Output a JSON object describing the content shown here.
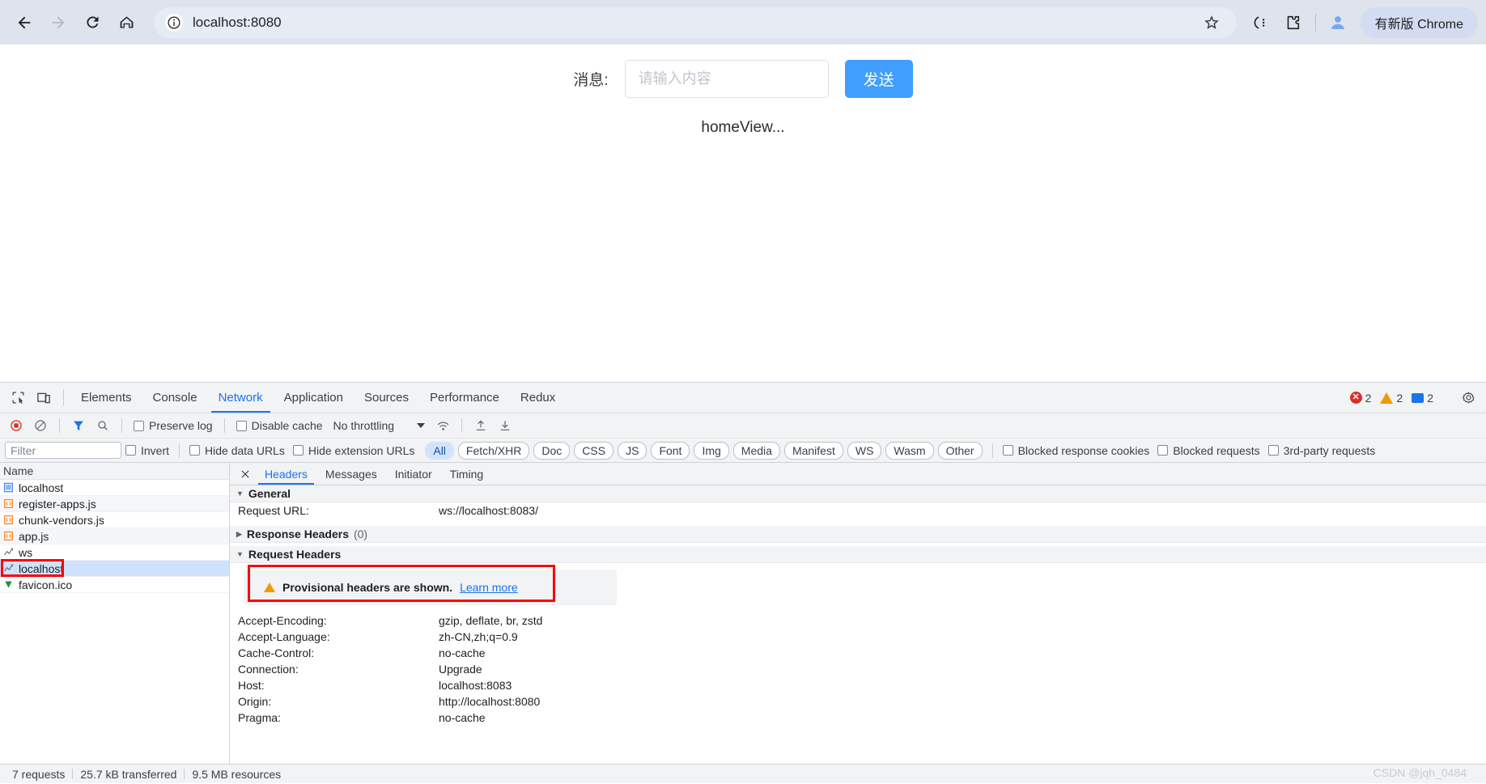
{
  "browser": {
    "back_icon": "arrow-left-icon",
    "forward_icon": "arrow-right-icon",
    "reload_icon": "reload-icon",
    "home_icon": "home-icon",
    "site_info_icon": "info-circle-icon",
    "url": "localhost:8080",
    "bookmark_icon": "star-icon",
    "side_panel_icon": "browser-essentials-icon",
    "extensions_icon": "puzzle-piece-icon",
    "profile_icon": "profile-avatar-icon",
    "update_chip_label": "有新版 Chrome"
  },
  "page": {
    "message_label": "消息:",
    "message_placeholder": "请输入内容",
    "message_value": "",
    "send_label": "发送",
    "home_text": "homeView...",
    "send_button_color": "#409eff"
  },
  "devtools": {
    "inspect_icon": "inspect-element-icon",
    "device_icon": "device-toolbar-icon",
    "tabs": [
      {
        "label": "Elements",
        "active": false
      },
      {
        "label": "Console",
        "active": false
      },
      {
        "label": "Network",
        "active": true
      },
      {
        "label": "Application",
        "active": false
      },
      {
        "label": "Sources",
        "active": false
      },
      {
        "label": "Performance",
        "active": false
      },
      {
        "label": "Redux",
        "active": false
      }
    ],
    "counters": {
      "errors": "2",
      "warnings": "2",
      "infos": "2",
      "error_color": "#d93025",
      "warning_color": "#f29900",
      "info_color": "#1a73e8"
    },
    "settings_icon": "gear-icon",
    "accent_color": "#1a73e8"
  },
  "network_toolbar": {
    "record_icon": "record-stop-icon",
    "clear_icon": "clear-icon",
    "filter_icon": "funnel-icon",
    "search_icon": "search-icon",
    "preserve_log_label": "Preserve log",
    "preserve_log_checked": false,
    "disable_cache_label": "Disable cache",
    "disable_cache_checked": false,
    "throttling_value": "No throttling",
    "throttling_caret_icon": "chevron-down-icon",
    "wifi_icon": "wifi-settings-icon",
    "import_icon": "upload-har-icon",
    "export_icon": "download-har-icon"
  },
  "filter_row": {
    "filter_placeholder": "Filter",
    "filter_value": "",
    "invert_label": "Invert",
    "hide_data_urls_label": "Hide data URLs",
    "hide_extension_urls_label": "Hide extension URLs",
    "type_chips": [
      {
        "label": "All",
        "active": true
      },
      {
        "label": "Fetch/XHR",
        "active": false
      },
      {
        "label": "Doc",
        "active": false
      },
      {
        "label": "CSS",
        "active": false
      },
      {
        "label": "JS",
        "active": false
      },
      {
        "label": "Font",
        "active": false
      },
      {
        "label": "Img",
        "active": false
      },
      {
        "label": "Media",
        "active": false
      },
      {
        "label": "Manifest",
        "active": false
      },
      {
        "label": "WS",
        "active": false
      },
      {
        "label": "Wasm",
        "active": false
      },
      {
        "label": "Other",
        "active": false
      }
    ],
    "blocked_response_cookies_label": "Blocked response cookies",
    "blocked_requests_label": "Blocked requests",
    "third_party_requests_label": "3rd-party requests"
  },
  "request_list": {
    "column_header": "Name",
    "rows": [
      {
        "name": "localhost",
        "icon": "document-icon",
        "selected": false
      },
      {
        "name": "register-apps.js",
        "icon": "script-icon",
        "selected": false
      },
      {
        "name": "chunk-vendors.js",
        "icon": "script-icon",
        "selected": false
      },
      {
        "name": "app.js",
        "icon": "script-icon",
        "selected": false
      },
      {
        "name": "ws",
        "icon": "websocket-icon",
        "selected": false
      },
      {
        "name": "localhost",
        "icon": "websocket-icon",
        "selected": true
      },
      {
        "name": "favicon.ico",
        "icon": "image-icon",
        "selected": false
      }
    ],
    "annotation_color": "#fb0007"
  },
  "details": {
    "close_icon": "close-icon",
    "tabs": [
      {
        "label": "Headers",
        "active": true
      },
      {
        "label": "Messages",
        "active": false
      },
      {
        "label": "Initiator",
        "active": false
      },
      {
        "label": "Timing",
        "active": false
      }
    ],
    "general_section": {
      "title": "General",
      "expanded": true,
      "rows": [
        {
          "key": "Request URL:",
          "value": "ws://localhost:8083/"
        }
      ]
    },
    "response_headers_section": {
      "title": "Response Headers",
      "count": "(0)",
      "expanded": false
    },
    "request_headers_section": {
      "title": "Request Headers",
      "expanded": true,
      "banner": {
        "warning_icon": "warning-triangle-icon",
        "text": "Provisional headers are shown.",
        "link_label": "Learn more"
      },
      "rows": [
        {
          "key": "Accept-Encoding:",
          "value": "gzip, deflate, br, zstd"
        },
        {
          "key": "Accept-Language:",
          "value": "zh-CN,zh;q=0.9"
        },
        {
          "key": "Cache-Control:",
          "value": "no-cache"
        },
        {
          "key": "Connection:",
          "value": "Upgrade"
        },
        {
          "key": "Host:",
          "value": "localhost:8083"
        },
        {
          "key": "Origin:",
          "value": "http://localhost:8080"
        },
        {
          "key": "Pragma:",
          "value": "no-cache"
        }
      ]
    }
  },
  "status_bar": {
    "requests": "7 requests",
    "transferred": "25.7 kB transferred",
    "resources": "9.5 MB resources"
  },
  "watermark": "CSDN @jqh_0484"
}
